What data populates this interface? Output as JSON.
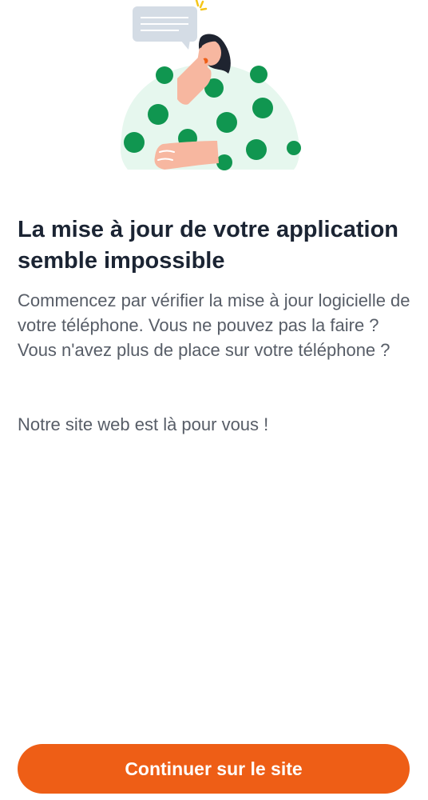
{
  "illustration": {
    "icon": "woman-thinking-speech-bubble-illustration",
    "colors": {
      "shirt": "#e6f7ee",
      "dots": "#109650",
      "skin": "#f7b7a0",
      "hair": "#1f2430",
      "bubble": "#d4dce5"
    }
  },
  "content": {
    "title": "La mise à jour de votre application semble impossible",
    "description": "Commencez par vérifier la mise à jour logicielle de votre téléphone. Vous ne pouvez pas la faire ? Vous n'avez plus de place sur votre téléphone ?",
    "secondary": "Notre site web est là pour vous !"
  },
  "actions": {
    "continue_label": "Continuer sur le site"
  },
  "theme": {
    "accent": "#ee5e16",
    "title_color": "#1b2433",
    "text_color": "#575d67"
  }
}
